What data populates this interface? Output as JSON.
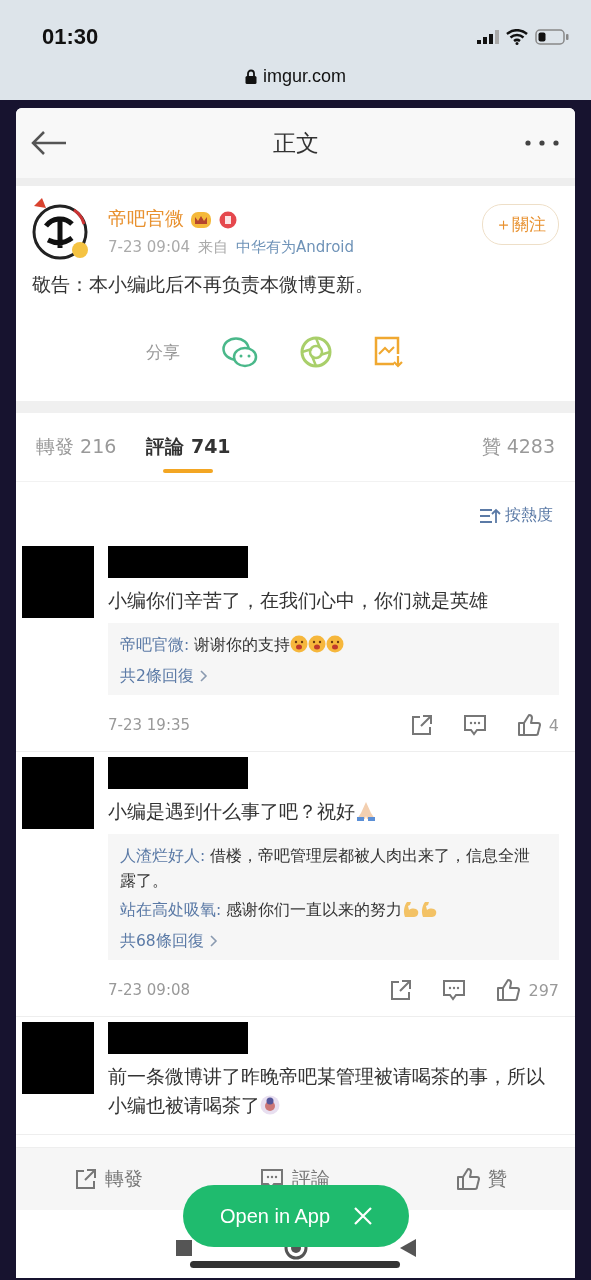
{
  "status_bar": {
    "time": "01:30",
    "url": "imgur.com"
  },
  "header": {
    "title": "正文"
  },
  "post": {
    "author": "帝吧官微",
    "time": "7-23 09:04",
    "source_prefix": "来自",
    "source": "中华有为Android",
    "follow": "＋關注",
    "text": "敬告：本小编此后不再负责本微博更新。",
    "share_label": "分享"
  },
  "tabs": [
    {
      "label": "轉發 216",
      "selected": false
    },
    {
      "label": "評論 741",
      "selected": true
    },
    {
      "label": "贊 4283",
      "selected": false
    }
  ],
  "sort": {
    "label": "按熱度"
  },
  "comments": [
    {
      "text": "小编你们辛苦了，在我们心中，你们就是英雄",
      "replies": [
        {
          "user": "帝吧官微:",
          "text": "谢谢你的支持"
        }
      ],
      "more": "共2條回復",
      "time": "7-23 19:35",
      "likes": "4"
    },
    {
      "text": "小编是遇到什么事了吧？祝好",
      "replies": [
        {
          "user": "人渣烂好人:",
          "text": "借楼，帝吧管理层都被人肉出来了，信息全泄露了。"
        },
        {
          "user": "站在高处吸氧:",
          "text": "感谢你们一直以来的努力"
        }
      ],
      "more": "共68條回復",
      "time": "7-23 09:08",
      "likes": "297"
    },
    {
      "text": "前一条微博讲了昨晚帝吧某管理被请喝茶的事，所以小编也被请喝茶了"
    }
  ],
  "bottom_bar": [
    {
      "label": "轉發",
      "kind": "repost"
    },
    {
      "label": "評論",
      "kind": "comment"
    },
    {
      "label": "贊",
      "kind": "like"
    }
  ],
  "open_in_app": {
    "label": "Open in App"
  }
}
